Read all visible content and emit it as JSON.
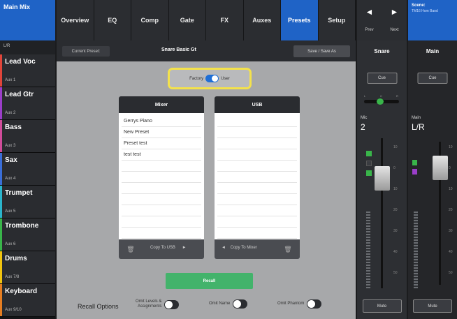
{
  "left": {
    "mix_title": "Main Mix",
    "lr_label": "L/R",
    "channels": [
      {
        "name": "Lead Voc",
        "aux": "Aux 1",
        "color": "#e0453a"
      },
      {
        "name": "Lead Gtr",
        "aux": "Aux 2",
        "color": "#9b3ec9"
      },
      {
        "name": "Bass",
        "aux": "Aux 3",
        "color": "#d04c9a"
      },
      {
        "name": "Sax",
        "aux": "Aux 4",
        "color": "#3a6ed8"
      },
      {
        "name": "Trumpet",
        "aux": "Aux 5",
        "color": "#2bb5cc"
      },
      {
        "name": "Trombone",
        "aux": "Aux 6",
        "color": "#39b54a"
      },
      {
        "name": "Drums",
        "aux": "Aux 7/8",
        "color": "#f1c40f"
      },
      {
        "name": "Keyboard",
        "aux": "Aux 9/10",
        "color": "#e67e22"
      }
    ]
  },
  "nav": {
    "tabs": [
      "Overview",
      "EQ",
      "Comp",
      "Gate",
      "FX",
      "Auxes",
      "Presets",
      "Setup"
    ],
    "active": "Presets"
  },
  "preset_bar": {
    "current_label": "Current Preset:",
    "current_value": "Snare Basic Gt",
    "save_label": "Save / Save As"
  },
  "toggle": {
    "left": "Factory",
    "right": "User"
  },
  "mixer_panel": {
    "title": "Mixer",
    "items": [
      "Gerrys Piano",
      "New Preset",
      "Preset test",
      "test test"
    ],
    "copy_label": "Copy To USB",
    "trash": "🗑",
    "copy_arrow": "►"
  },
  "usb_panel": {
    "title": "USB",
    "items": [],
    "copy_label": "Copy To Mixer",
    "trash": "🗑",
    "copy_arrow": "◄"
  },
  "recall": {
    "label": "Recall"
  },
  "recall_options": {
    "title": "Recall Options",
    "opt1_line1": "Omit Levels &",
    "opt1_line2": "Assignments",
    "opt2": "Omit Name",
    "opt3": "Omit Phantom"
  },
  "prevnext": {
    "prev": "Prev",
    "next": "Next",
    "prev_icon": "◄",
    "next_icon": "►"
  },
  "scene": {
    "label": "Scene:",
    "value": "TM16 Hom Band"
  },
  "snare_strip": {
    "title": "Snare",
    "cue": "Cue",
    "pan_letters": {
      "l": "L",
      "c": "C",
      "r": "R"
    },
    "input": "Mic",
    "input_num": "2",
    "mute": "Mute",
    "ticks": [
      "10",
      "0",
      "10",
      "20",
      "30",
      "40",
      "50"
    ]
  },
  "main_strip": {
    "title": "Main",
    "cue": "Cue",
    "out_label": "Main",
    "out_name": "L/R",
    "mute": "Mute",
    "ticks": [
      "10",
      "0",
      "10",
      "20",
      "30",
      "40",
      "50"
    ]
  },
  "colors": {
    "accent": "#1f63c6",
    "recall": "#43b36b",
    "highlight": "#f4e24b"
  }
}
